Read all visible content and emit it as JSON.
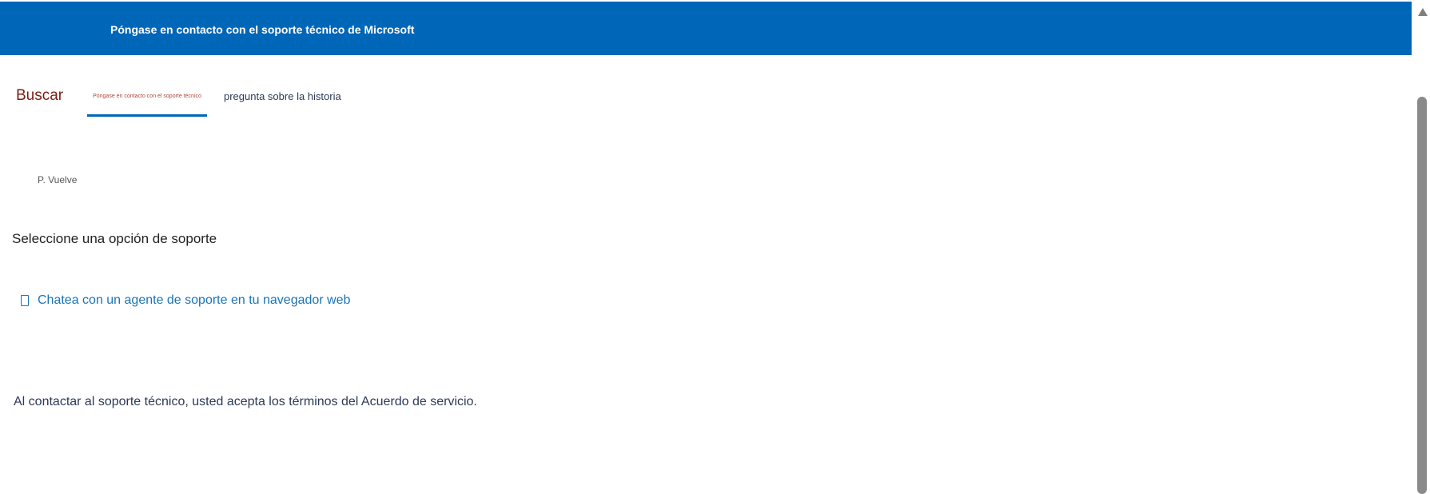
{
  "header": {
    "title": "Póngase en contacto con el soporte técnico de Microsoft",
    "color": "#0067b8"
  },
  "tabs": {
    "search_label": "Buscar",
    "contact_label": "Póngase en contacto con el soporte técnico",
    "history_label": "pregunta sobre la historia",
    "active_tab": "contact"
  },
  "main": {
    "back_link": "P. Vuelve",
    "heading": "Seleccione una opción de soporte",
    "options": [
      {
        "label": "Chatea con un agente de soporte en tu navegador web",
        "icon": "chat-window-icon"
      }
    ],
    "terms_text": "Al contactar al soporte técnico, usted acepta los términos del Acuerdo de servicio."
  },
  "colors": {
    "accent": "#0067b8",
    "link": "#1a73b8",
    "search_tab": "#7b1e12"
  }
}
